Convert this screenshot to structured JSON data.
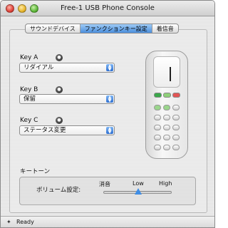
{
  "window": {
    "title": "Free-1 USB Phone Console"
  },
  "tabs": [
    {
      "label": "サウンドデバイス",
      "active": false
    },
    {
      "label": "ファンクションキー設定",
      "active": true
    },
    {
      "label": "着信音",
      "active": false
    }
  ],
  "keys": [
    {
      "label": "Key A",
      "value": "リダイアル"
    },
    {
      "label": "Key B",
      "value": "保留"
    },
    {
      "label": "Key C",
      "value": "ステータス変更"
    }
  ],
  "tone": {
    "group_label": "キートーン",
    "volume_label": "ボリューム設定:",
    "ticks": [
      "消音",
      "Low",
      "High"
    ],
    "selected_level": "Low"
  },
  "status": {
    "text": "Ready"
  },
  "colors": {
    "accent": "#4b8fdc",
    "phone_green": "#3aa84a",
    "phone_red": "#d43b3b"
  },
  "icons": {
    "info": "info-icon",
    "status": "status-icon"
  }
}
